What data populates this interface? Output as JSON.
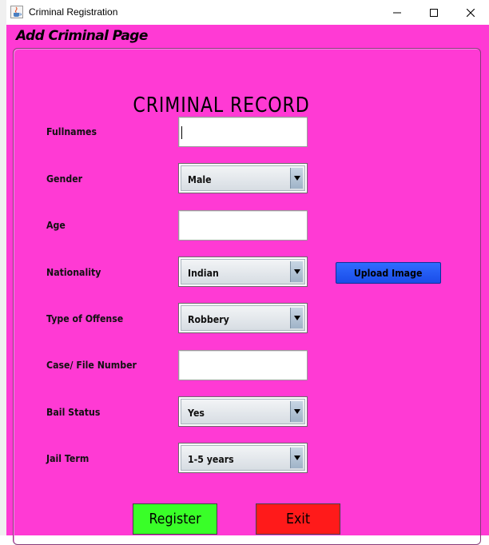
{
  "window": {
    "title": "Criminal Registration",
    "icons": {
      "app": "java-cup-icon",
      "minimize": "minimize-icon",
      "maximize": "maximize-icon",
      "close": "close-icon"
    }
  },
  "header": {
    "label": "Add Criminal Page"
  },
  "form": {
    "title": "CRIMINAL RECORD",
    "fields": {
      "fullnames": {
        "label": "Fullnames",
        "value": ""
      },
      "gender": {
        "label": "Gender",
        "selected": "Male"
      },
      "age": {
        "label": "Age",
        "value": ""
      },
      "nationality": {
        "label": "Nationality",
        "selected": "Indian"
      },
      "offense": {
        "label": "Type of Offense",
        "selected": "Robbery"
      },
      "case_number": {
        "label": "Case/ File Number",
        "value": ""
      },
      "bail": {
        "label": "Bail Status",
        "selected": "Yes"
      },
      "jail_term": {
        "label": "Jail Term",
        "selected": "1-5 years"
      }
    },
    "upload_label": "Upload Image",
    "register_label": "Register",
    "exit_label": "Exit"
  },
  "colors": {
    "background": "#ff3ad4",
    "upload_button": "#1a4de8",
    "register_button": "#39ff28",
    "exit_button": "#ff1a1a"
  }
}
